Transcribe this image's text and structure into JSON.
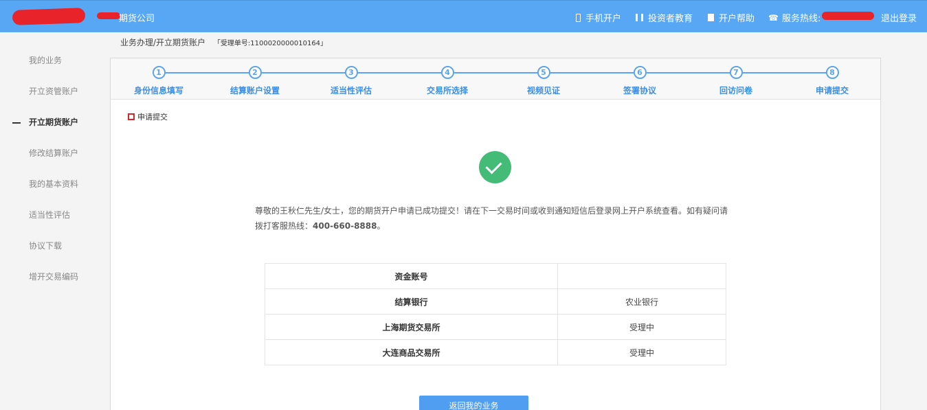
{
  "header": {
    "company_name": "期货公司",
    "nav": {
      "mobile_open": "手机开户",
      "investor_edu": "投资者教育",
      "help": "开户帮助",
      "hotline_label": "服务热线:",
      "logout": "退出登录"
    }
  },
  "breadcrumb": {
    "path": "业务办理/开立期货账户",
    "ticket": "「受理单号:1100020000010164」"
  },
  "sidebar": {
    "items": [
      {
        "label": "我的业务"
      },
      {
        "label": "开立资管账户"
      },
      {
        "label": "开立期货账户"
      },
      {
        "label": "修改结算账户"
      },
      {
        "label": "我的基本资料"
      },
      {
        "label": "适当性评估"
      },
      {
        "label": "协议下载"
      },
      {
        "label": "增开交易编码"
      }
    ],
    "active_index": 2
  },
  "steps": [
    {
      "num": "1",
      "label": "身份信息填写"
    },
    {
      "num": "2",
      "label": "结算账户设置"
    },
    {
      "num": "3",
      "label": "适当性评估"
    },
    {
      "num": "4",
      "label": "交易所选择"
    },
    {
      "num": "5",
      "label": "视频见证"
    },
    {
      "num": "6",
      "label": "签署协议"
    },
    {
      "num": "7",
      "label": "回访问卷"
    },
    {
      "num": "8",
      "label": "申请提交"
    }
  ],
  "section_title": "申请提交",
  "message": {
    "text": "尊敬的王秋仁先生/女士，您的期货开户申请已成功提交！请在下一交易时间或收到通知短信后登录网上开户系统查看。如有疑问请拨打客服热线：",
    "hotline": "400-660-8888",
    "end": "。"
  },
  "info_table": [
    {
      "key": "资金账号",
      "value": ""
    },
    {
      "key": "结算银行",
      "value": "农业银行"
    },
    {
      "key": "上海期货交易所",
      "value": "受理中"
    },
    {
      "key": "大连商品交易所",
      "value": "受理中"
    }
  ],
  "return_button": "返回我的业务",
  "colors": {
    "header_bg": "#58a7f4",
    "step_accent": "#5aa3ef",
    "success": "#44bb77",
    "button": "#4f9ef1",
    "redaction": "#e8242a"
  }
}
